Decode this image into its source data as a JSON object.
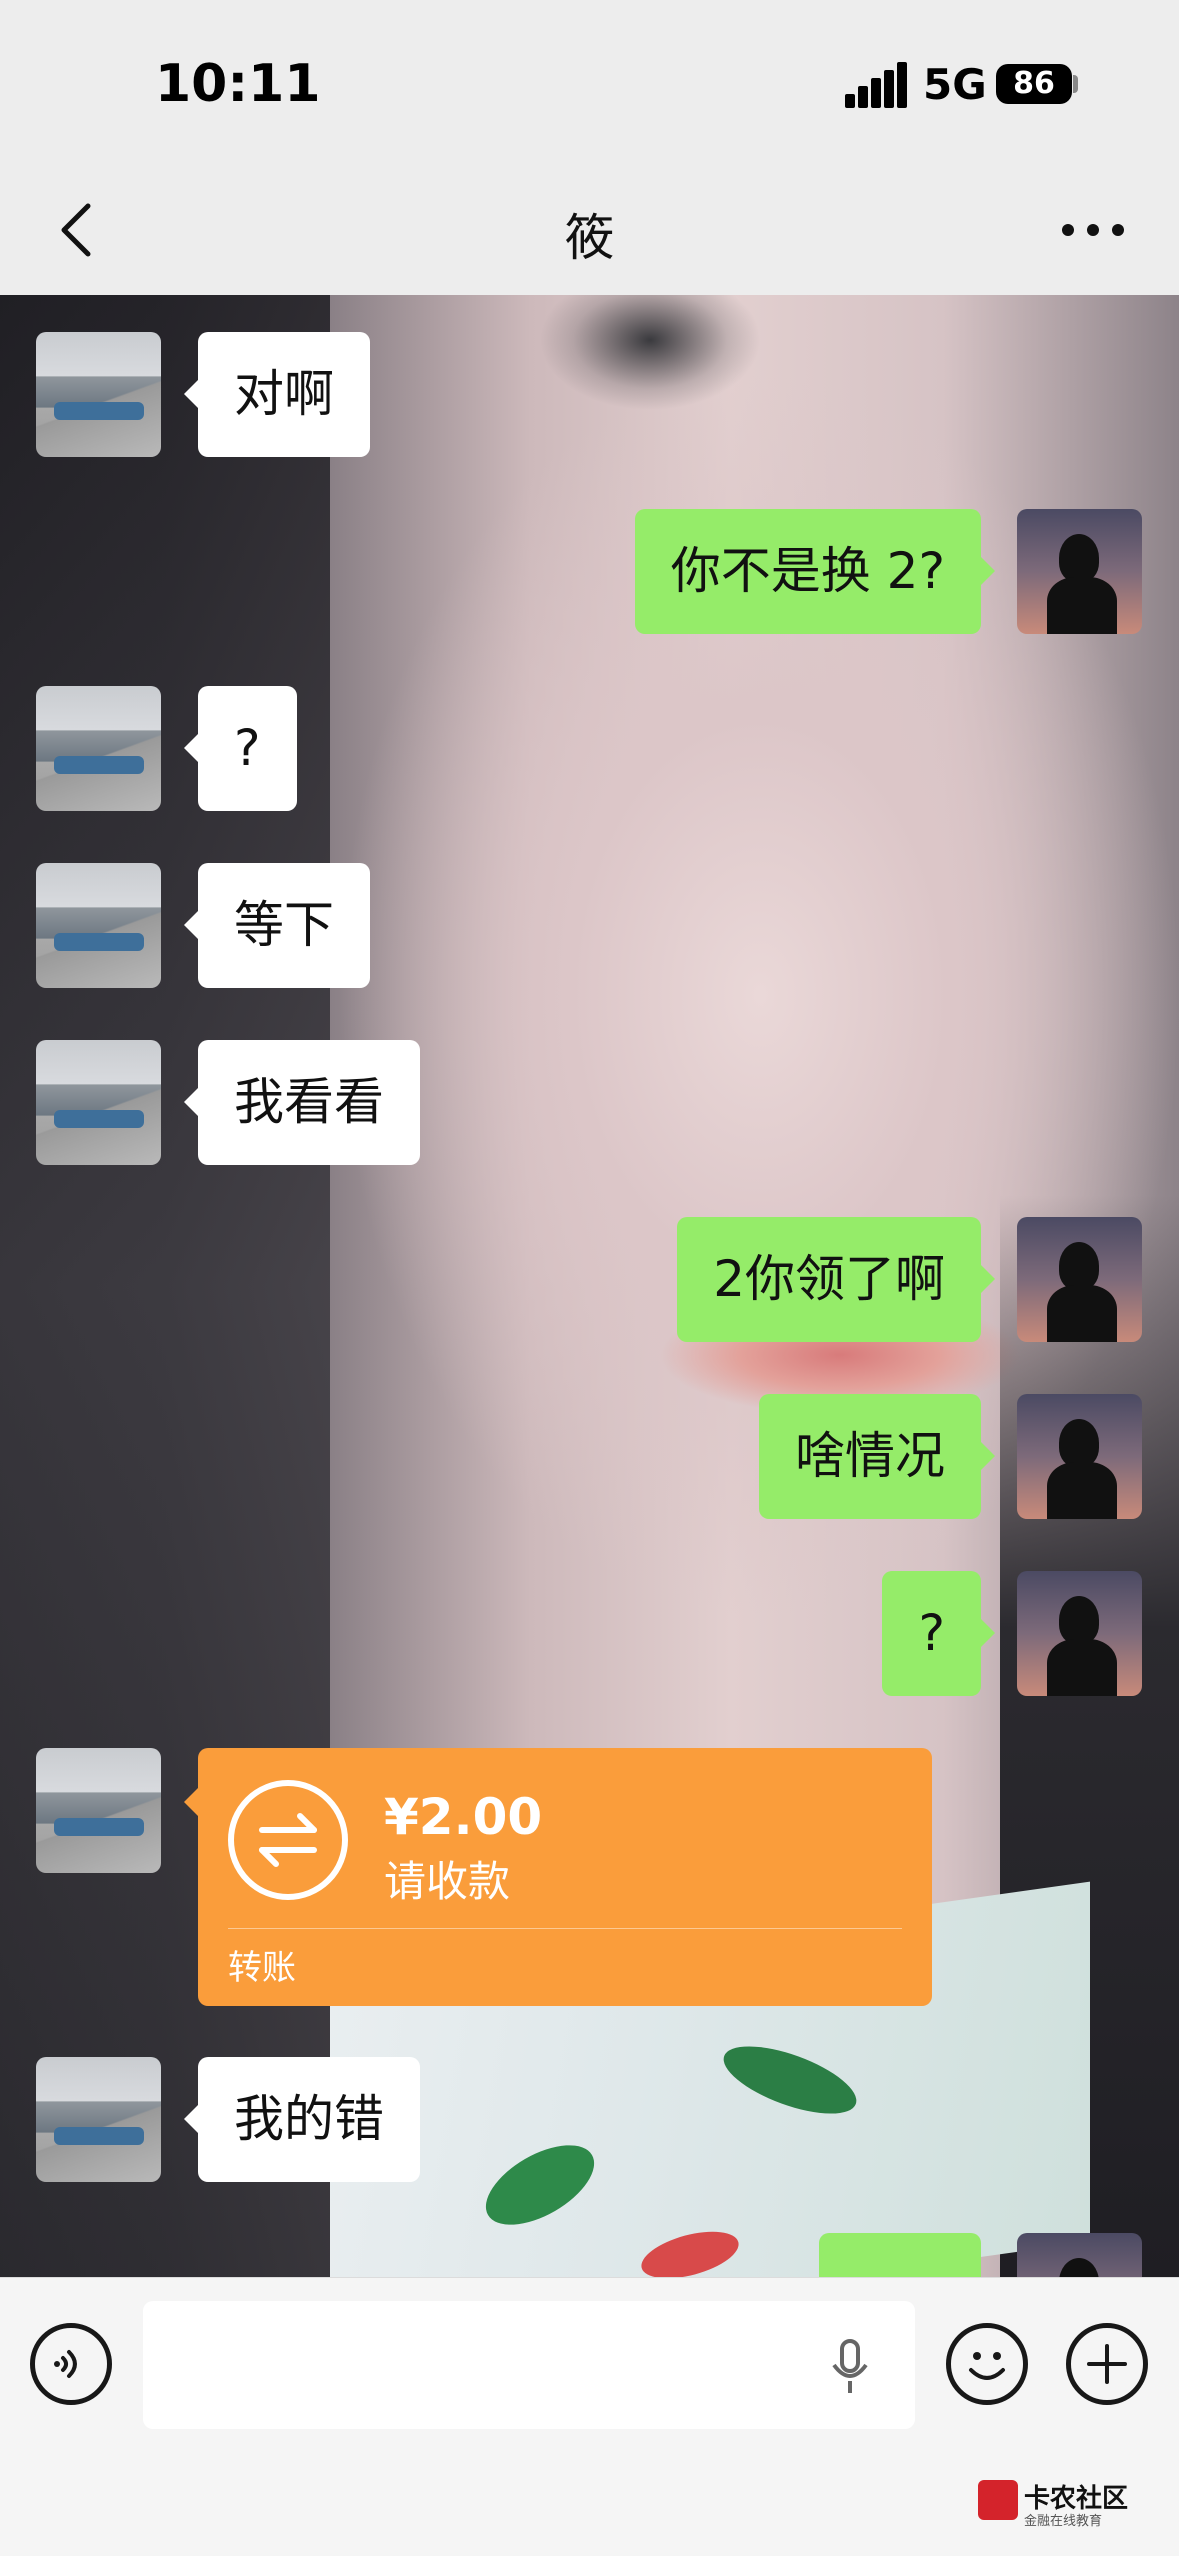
{
  "status_bar": {
    "time": "10:11",
    "network": "5G",
    "battery": "86"
  },
  "header": {
    "title": "筱"
  },
  "messages": [
    {
      "side": "in",
      "text": "对啊"
    },
    {
      "side": "out",
      "text": "你不是换 2?"
    },
    {
      "side": "in",
      "text": "?"
    },
    {
      "side": "in",
      "text": "等下"
    },
    {
      "side": "in",
      "text": "我看看"
    },
    {
      "side": "out",
      "text": "2你领了啊"
    },
    {
      "side": "out",
      "text": "啥情况"
    },
    {
      "side": "out",
      "text": "?"
    },
    {
      "side": "in",
      "type": "transfer",
      "amount": "¥2.00",
      "status": "请收款",
      "label": "转账"
    },
    {
      "side": "in",
      "text": "我的错"
    }
  ],
  "colors": {
    "outgoing_bubble": "#95ec69",
    "incoming_bubble": "#ffffff",
    "transfer_card": "#fa9d3b"
  },
  "icons": [
    "back-icon",
    "more-icon",
    "voice-icon",
    "microphone-icon",
    "emoji-icon",
    "plus-icon",
    "transfer-icon"
  ],
  "watermark": {
    "title": "卡农社区",
    "subtitle": "金融在线教育"
  }
}
